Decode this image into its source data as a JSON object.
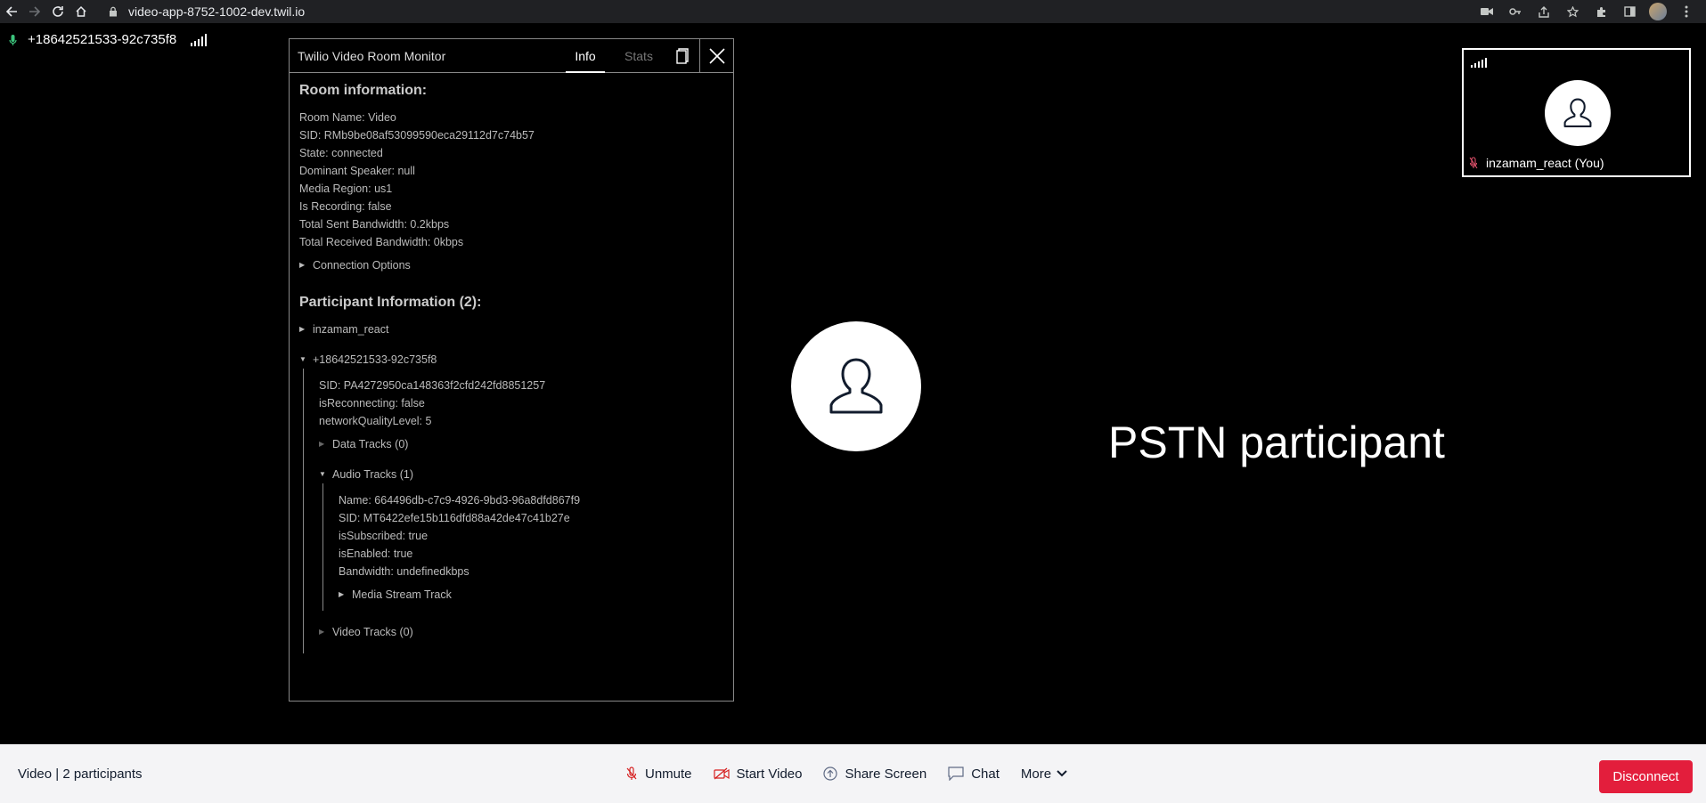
{
  "browser": {
    "url": "video-app-8752-1002-dev.twil.io"
  },
  "local_label": {
    "identity": "+18642521533-92c735f8"
  },
  "monitor": {
    "title": "Twilio Video Room Monitor",
    "tabs": {
      "info": "Info",
      "stats": "Stats"
    },
    "room_heading": "Room information:",
    "room": {
      "name": "Room Name: Video",
      "sid": "SID: RMb9be08af53099590eca29112d7c74b57",
      "state": "State: connected",
      "dominant": "Dominant Speaker: null",
      "region": "Media Region: us1",
      "recording": "Is Recording: false",
      "sent_bw": "Total Sent Bandwidth: 0.2kbps",
      "recv_bw": "Total Received Bandwidth: 0kbps",
      "conn_options": "Connection Options"
    },
    "participants_heading": "Participant Information (2):",
    "participant1": "inzamam_react",
    "participant2": {
      "name": "+18642521533-92c735f8",
      "sid": "SID: PA4272950ca148363f2cfd242fd8851257",
      "reconnecting": "isReconnecting: false",
      "nql": "networkQualityLevel: 5",
      "data_tracks": "Data Tracks (0)",
      "audio_tracks": "Audio Tracks (1)",
      "audio": {
        "name": "Name: 664496db-c7c9-4926-9bd3-96a8dfd867f9",
        "sid": "SID: MT6422efe15b116dfd88a42de47c41b27e",
        "subscribed": "isSubscribed: true",
        "enabled": "isEnabled: true",
        "bandwidth": "Bandwidth: undefinedkbps",
        "media_stream": "Media Stream Track"
      },
      "video_tracks": "Video Tracks (0)"
    }
  },
  "remote": {
    "label": "PSTN participant"
  },
  "preview": {
    "name": "inzamam_react (You)"
  },
  "footer": {
    "room_info": "Video | 2 participants",
    "unmute": "Unmute",
    "start_video": "Start Video",
    "share_screen": "Share Screen",
    "chat": "Chat",
    "more": "More",
    "disconnect": "Disconnect"
  },
  "colors": {
    "disconnect": "#e31e3c",
    "mic_on": "#3cc47c",
    "mic_muted": "#e0516b"
  }
}
